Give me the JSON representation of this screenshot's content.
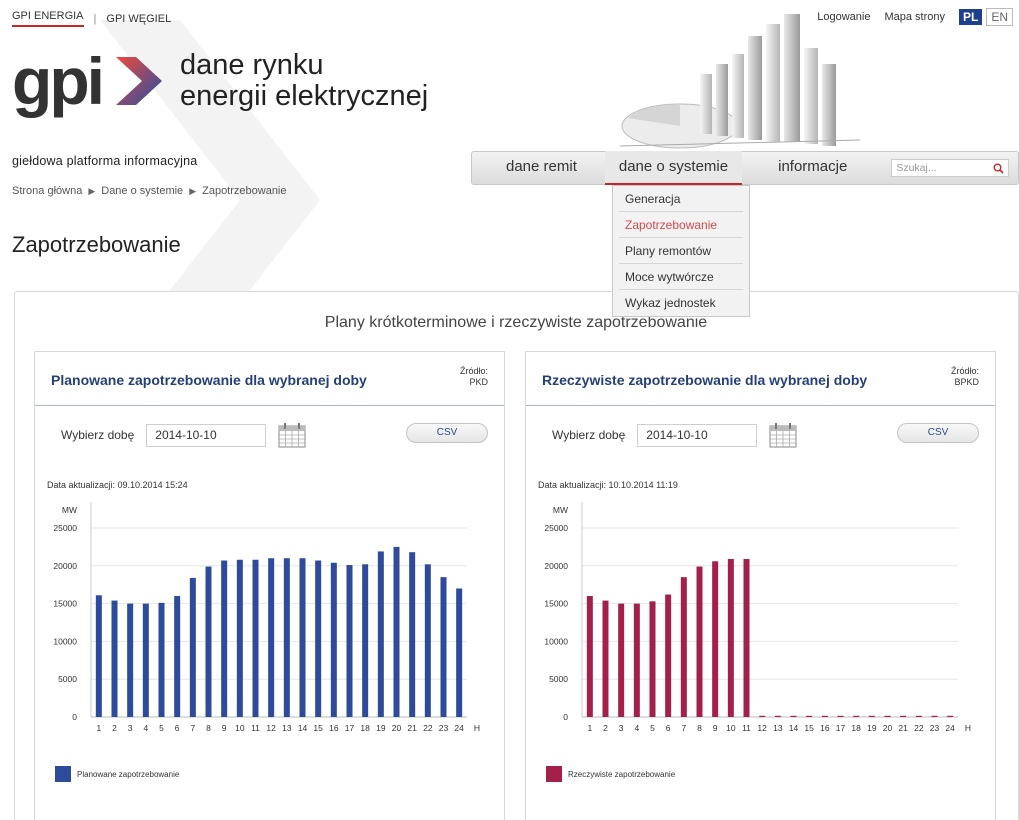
{
  "header": {
    "top_links": [
      "GPI ENERGIA",
      "GPI WĘGIEL"
    ],
    "login": "Logowanie",
    "sitemap": "Mapa strony",
    "lang_pl": "PL",
    "lang_en": "EN",
    "logo_text": "gpi",
    "tagline_1": "dane rynku",
    "tagline_2": "energii elektrycznej",
    "platform": "giełdowa platforma informacyjna"
  },
  "breadcrumb": [
    "Strona główna",
    "Dane o systemie",
    "Zapotrzebowanie"
  ],
  "nav": {
    "items": [
      "dane remit",
      "dane o systemie",
      "informacje"
    ],
    "search_placeholder": "Szukaj..."
  },
  "dropdown": {
    "items": [
      "Generacja",
      "Zapotrzebowanie",
      "Plany remontów",
      "Moce wytwórcze",
      "Wykaz jednostek"
    ],
    "active_index": 1
  },
  "page_title": "Zapotrzebowanie",
  "panel_title": "Plany krótkoterminowe i rzeczywiste zapotrzebowanie",
  "cards": [
    {
      "title": "Planowane zapotrzebowanie dla wybranej doby",
      "source_label": "Źródło:",
      "source": "PKD",
      "date_label": "Wybierz dobę",
      "date_value": "2014-10-10",
      "csv": "CSV",
      "updated": "Data aktualizacji: 09.10.2014 15:24",
      "legend": "Planowane zapotrzebowanie"
    },
    {
      "title": "Rzeczywiste zapotrzebowanie dla wybranej doby",
      "source_label": "Źródło:",
      "source": "BPKD",
      "date_label": "Wybierz dobę",
      "date_value": "2014-10-10",
      "csv": "CSV",
      "updated": "Data aktualizacji: 10.10.2014 11:19",
      "legend": "Rzeczywiste zapotrzebowanie"
    }
  ],
  "chart_data": [
    {
      "type": "bar",
      "ylabel": "MW",
      "xlabel": "H",
      "ylim": [
        0,
        25000
      ],
      "yticks": [
        0,
        5000,
        10000,
        15000,
        20000,
        25000
      ],
      "categories": [
        "1",
        "2",
        "3",
        "4",
        "5",
        "6",
        "7",
        "8",
        "9",
        "10",
        "11",
        "12",
        "13",
        "14",
        "15",
        "16",
        "17",
        "18",
        "19",
        "20",
        "21",
        "22",
        "23",
        "24"
      ],
      "series": [
        {
          "name": "Planowane zapotrzebowanie",
          "color": "#2e4a9a",
          "values": [
            16100,
            15400,
            15000,
            15000,
            15100,
            16000,
            18400,
            19900,
            20700,
            20800,
            20800,
            21000,
            21000,
            21000,
            20700,
            20400,
            20100,
            20200,
            21900,
            22500,
            21800,
            20200,
            18500,
            17000
          ]
        }
      ],
      "grid": true
    },
    {
      "type": "bar",
      "ylabel": "MW",
      "xlabel": "H",
      "ylim": [
        0,
        25000
      ],
      "yticks": [
        0,
        5000,
        10000,
        15000,
        20000,
        25000
      ],
      "categories": [
        "1",
        "2",
        "3",
        "4",
        "5",
        "6",
        "7",
        "8",
        "9",
        "10",
        "11",
        "12",
        "13",
        "14",
        "15",
        "16",
        "17",
        "18",
        "19",
        "20",
        "21",
        "22",
        "23",
        "24"
      ],
      "series": [
        {
          "name": "Rzeczywiste zapotrzebowanie",
          "color": "#a3204b",
          "values": [
            16000,
            15400,
            15000,
            15000,
            15300,
            16200,
            18500,
            19900,
            20600,
            20900,
            20900,
            0,
            0,
            0,
            0,
            0,
            0,
            0,
            0,
            0,
            0,
            0,
            0,
            0
          ]
        }
      ],
      "grid": true
    }
  ]
}
